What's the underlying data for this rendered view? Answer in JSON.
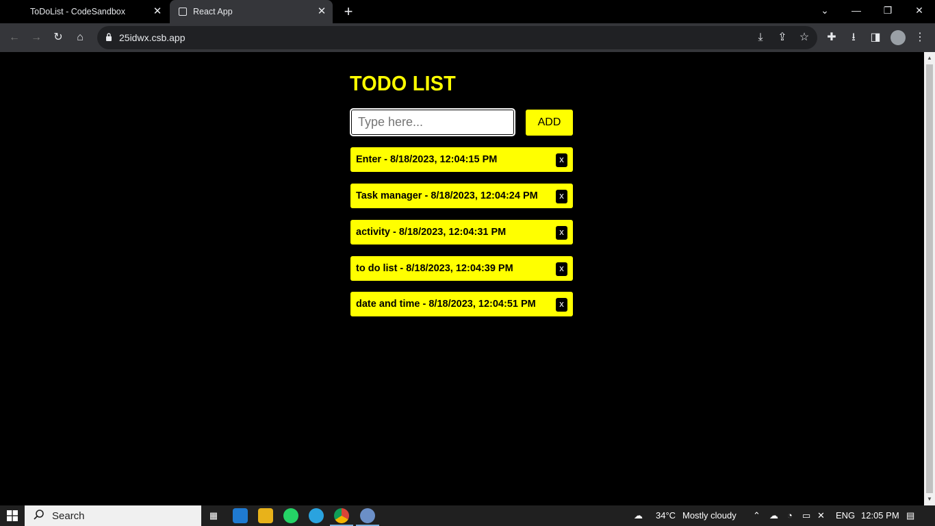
{
  "browser": {
    "tabs": [
      {
        "title": "ToDoList - CodeSandbox",
        "active": false
      },
      {
        "title": "React App",
        "active": true
      }
    ],
    "url": "25idwx.csb.app"
  },
  "app": {
    "title": "TODO LIST",
    "input_placeholder": "Type here...",
    "input_value": "",
    "add_label": "ADD",
    "delete_label": "x",
    "items": [
      "Enter - 8/18/2023, 12:04:15 PM",
      "Task manager - 8/18/2023, 12:04:24 PM",
      "activity - 8/18/2023, 12:04:31 PM",
      "to do list - 8/18/2023, 12:04:39 PM",
      "date and time - 8/18/2023, 12:04:51 PM"
    ],
    "accent_color": "#ffff00",
    "background_color": "#000000"
  },
  "taskbar": {
    "search_label": "Search",
    "weather": {
      "temp": "34°C",
      "condition": "Mostly cloudy"
    },
    "language": "ENG",
    "time": "12:05 PM"
  }
}
